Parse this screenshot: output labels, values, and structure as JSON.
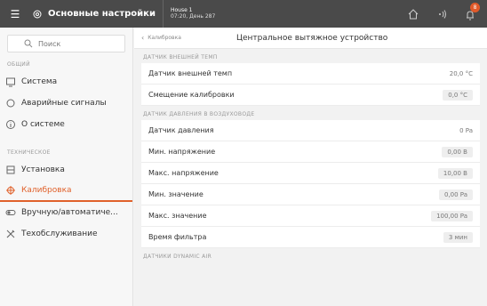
{
  "topbar": {
    "title": "Основные настройки",
    "house": "House 1",
    "datetime": "07:20, День 287",
    "notification_count": "8",
    "icons": [
      "menu-icon",
      "gear-icon",
      "home-icon",
      "signal-icon",
      "bell-icon"
    ]
  },
  "sidebar": {
    "search_placeholder": "Поиск",
    "general_header": "ОБЩИЙ",
    "technical_header": "ТЕХНИЧЕСКОЕ",
    "items_general": [
      {
        "label": "Система"
      },
      {
        "label": "Аварийные сигналы"
      },
      {
        "label": "О системе"
      }
    ],
    "items_technical": [
      {
        "label": "Установка"
      },
      {
        "label": "Калибровка"
      },
      {
        "label": "Вручную/автоматиче..."
      },
      {
        "label": "Техобслуживание"
      }
    ]
  },
  "main": {
    "back_label": "Калибровка",
    "title": "Центральное вытяжное устройство",
    "groups": [
      {
        "header": "ДАТЧИК ВНЕШНЕЙ ТЕМП",
        "rows": [
          {
            "label": "Датчик внешней темп",
            "value": "20,0 °C"
          },
          {
            "label": "Смещение калибровки",
            "value": "0,0 °C"
          }
        ]
      },
      {
        "header": "ДАТЧИК ДАВЛЕНИЯ В ВОЗДУХОВОДЕ",
        "rows": [
          {
            "label": "Датчик давления",
            "value": "0 Pa"
          },
          {
            "label": "Мин. напряжение",
            "value": "0,00 В"
          },
          {
            "label": "Макс. напряжение",
            "value": "10,00 В"
          },
          {
            "label": "Мин. значение",
            "value": "0,00 Pa"
          },
          {
            "label": "Макс. значение",
            "value": "100,00 Pa"
          },
          {
            "label": "Время фильтра",
            "value": "3 мин"
          }
        ]
      },
      {
        "header": "ДАТЧИКИ DYNAMIC AIR",
        "rows": []
      }
    ]
  },
  "colors": {
    "accent": "#e0612b",
    "topbar": "#4a4a4a"
  }
}
